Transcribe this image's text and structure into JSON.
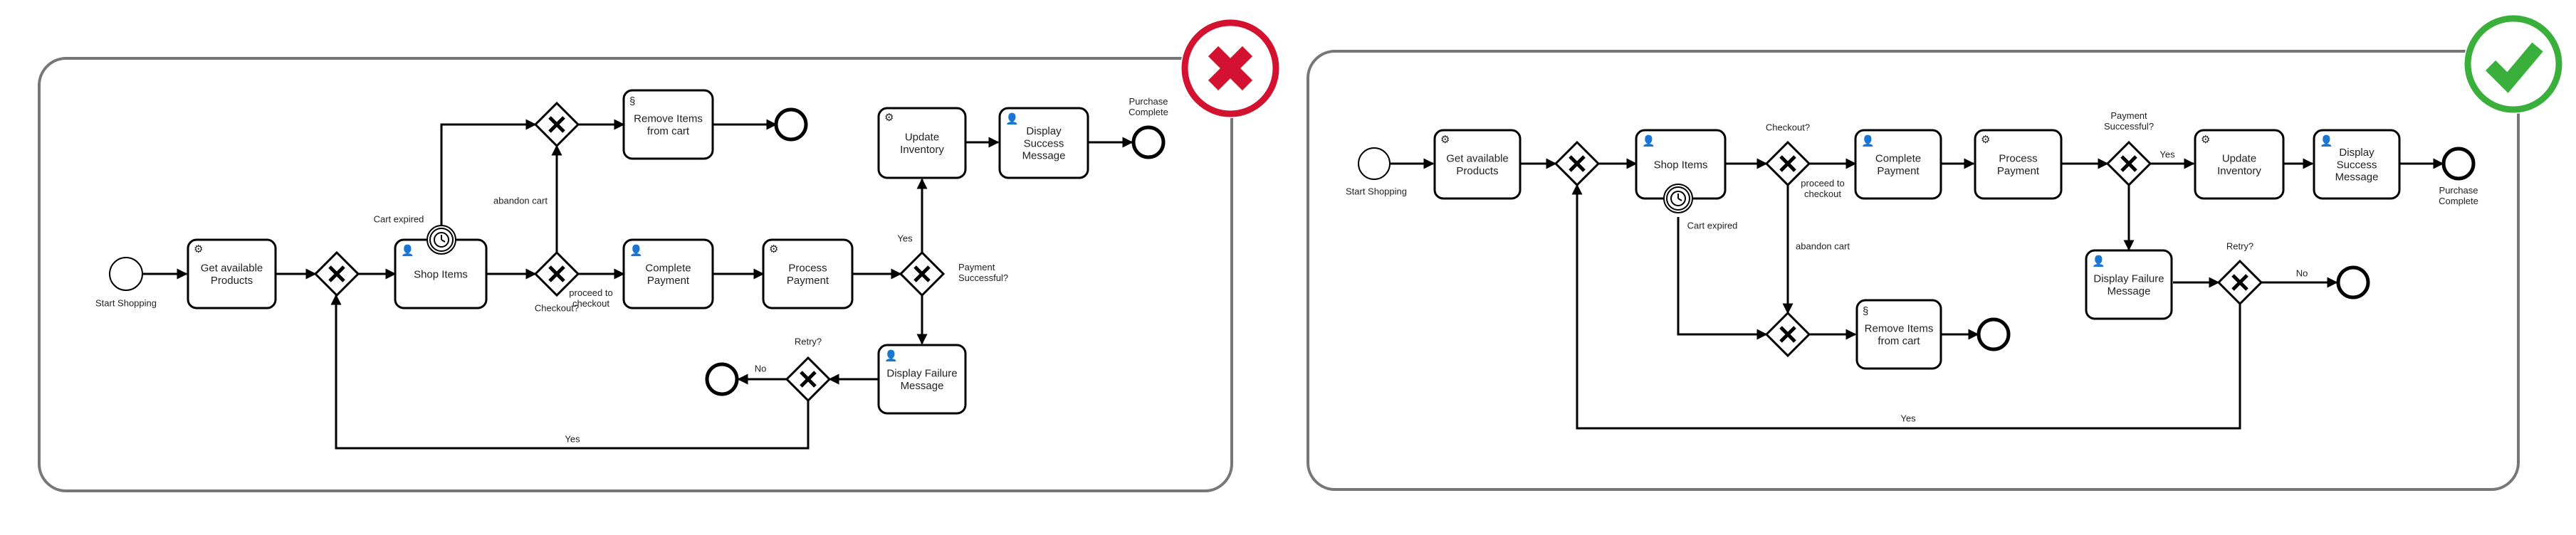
{
  "panels": [
    {
      "id": "bad",
      "verdict": "incorrect",
      "badge_color": "#D2122E",
      "labels": {
        "start": "Start Shopping",
        "get_products": "Get available|Products",
        "shop_items": "Shop Items",
        "remove_items": "Remove Items|from cart",
        "complete_payment": "Complete|Payment",
        "process_payment": "Process|Payment",
        "update_inventory": "Update|Inventory",
        "display_success": "Display|Success|Message",
        "display_failure": "Display Failure|Message",
        "purchase_complete": "Purchase|Complete",
        "cart_expired": "Cart expired",
        "abandon_cart": "abandon cart",
        "checkout": "Checkout?",
        "proceed": "proceed to|checkout",
        "payment_successful": "Payment|Successful?",
        "yes_payment": "Yes",
        "retry": "Retry?",
        "no": "No",
        "yes_loop": "Yes"
      }
    },
    {
      "id": "good",
      "verdict": "correct",
      "badge_color": "#3BAF3B",
      "labels": {
        "start": "Start Shopping",
        "get_products": "Get available|Products",
        "shop_items": "Shop Items",
        "checkout": "Checkout?",
        "proceed": "proceed to|checkout",
        "complete_payment": "Complete|Payment",
        "process_payment": "Process|Payment",
        "payment_successful": "Payment|Successful?",
        "yes_payment": "Yes",
        "update_inventory": "Update|Inventory",
        "display_success": "Display|Success|Message",
        "purchase_complete": "Purchase|Complete",
        "cart_expired": "Cart expired",
        "abandon_cart": "abandon cart",
        "remove_items": "Remove Items|from cart",
        "display_failure": "Display Failure|Message",
        "retry": "Retry?",
        "no": "No",
        "yes_loop": "Yes"
      }
    }
  ]
}
